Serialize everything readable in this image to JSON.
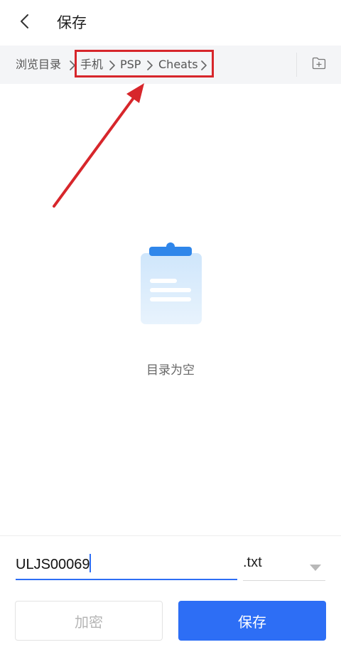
{
  "header": {
    "back_icon": "chevron-left-icon",
    "title": "保存"
  },
  "breadcrumb": {
    "items": [
      {
        "label": "浏览目录"
      },
      {
        "label": "手机"
      },
      {
        "label": "PSP"
      },
      {
        "label": "Cheats"
      }
    ],
    "separator_icon": "chevron-right-icon",
    "new_folder_icon": "new-folder-icon"
  },
  "annotation": {
    "highlight_color": "#d7262b"
  },
  "empty_state": {
    "icon": "clipboard-icon",
    "message": "目录为空"
  },
  "save_form": {
    "filename_value": "ULJS00069",
    "extension": ".txt",
    "encrypt_label": "加密",
    "save_label": "保存"
  },
  "colors": {
    "accent": "#2d6ef5",
    "pathbar_bg": "#f4f5f7"
  }
}
